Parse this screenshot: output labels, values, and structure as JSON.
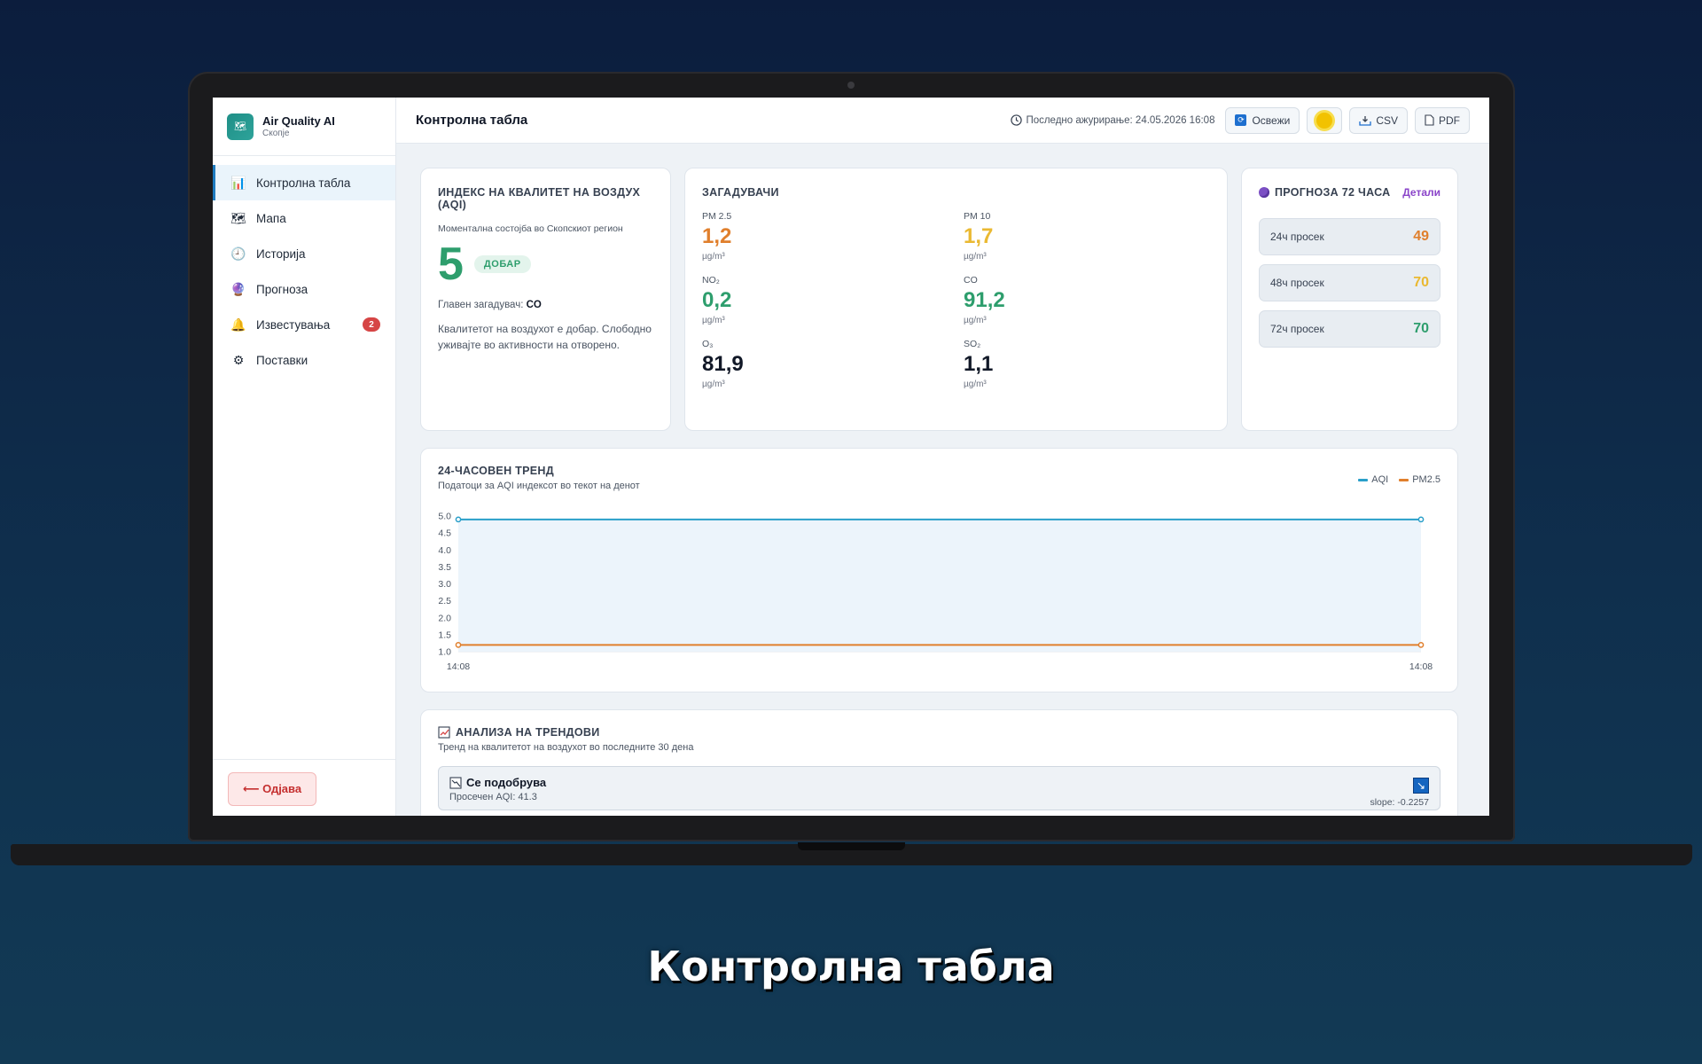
{
  "app": {
    "name": "Air Quality AI",
    "city": "Скопје",
    "logo_glyph": "🗺"
  },
  "sidebar": {
    "items": [
      {
        "label": "Контролна табла",
        "icon": "bar-chart-icon",
        "glyph": "📊",
        "active": true
      },
      {
        "label": "Мапа",
        "icon": "map-icon",
        "glyph": "🗺",
        "active": false
      },
      {
        "label": "Историја",
        "icon": "clock-icon",
        "glyph": "🕘",
        "active": false
      },
      {
        "label": "Прогноза",
        "icon": "crystal-ball-icon",
        "glyph": "🔮",
        "active": false
      },
      {
        "label": "Известувања",
        "icon": "bell-icon",
        "glyph": "🔔",
        "active": false,
        "badge": "2"
      },
      {
        "label": "Поставки",
        "icon": "gear-icon",
        "glyph": "⚙",
        "active": false
      }
    ],
    "logout_label": "⟵ Одјава"
  },
  "header": {
    "title": "Контролна табла",
    "last_updated": "Последно ажурирање: 24.05.2026 16:08",
    "refresh_label": "Освежи",
    "csv_label": "CSV",
    "pdf_label": "PDF"
  },
  "aqi": {
    "title": "ИНДЕКС НА КВАЛИТЕТ НА ВОЗДУХ (AQI)",
    "subtitle": "Моментална состојба во Скопскиот регион",
    "value": "5",
    "badge": "ДОБАР",
    "main_pollutant_label": "Главен загадувач:",
    "main_pollutant": "CO",
    "description": "Квалитетот на воздухот е добар. Слободно уживајте во активности на отворено.",
    "color": "#2e9e6d"
  },
  "pollutants": {
    "title": "ЗАГАДУВАЧИ",
    "items": [
      {
        "name": "PM 2.5",
        "value": "1,2",
        "unit": "µg/m³",
        "color": "#e07f2c"
      },
      {
        "name": "PM 10",
        "value": "1,7",
        "unit": "µg/m³",
        "color": "#eab932"
      },
      {
        "name": "NO₂",
        "value": "0,2",
        "unit": "µg/m³",
        "color": "#2e9e6d"
      },
      {
        "name": "CO",
        "value": "91,2",
        "unit": "µg/m³",
        "color": "#2e9e6d"
      },
      {
        "name": "O₃",
        "value": "81,9",
        "unit": "µg/m³",
        "color": "#111827"
      },
      {
        "name": "SO₂",
        "value": "1,1",
        "unit": "µg/m³",
        "color": "#111827"
      }
    ]
  },
  "forecast": {
    "title": "ПРОГНОЗА 72 ЧАСА",
    "details_label": "Детали",
    "items": [
      {
        "label": "24ч просек",
        "value": "49",
        "color": "#e07f2c"
      },
      {
        "label": "48ч просек",
        "value": "70",
        "color": "#eab932"
      },
      {
        "label": "72ч просек",
        "value": "70",
        "color": "#2e9e6d"
      }
    ]
  },
  "trend": {
    "title": "24-ЧАСОВЕН ТРЕНД",
    "subtitle": "Податоци за AQI индексот во текот на денот"
  },
  "chart_data": {
    "type": "line",
    "x": [
      "14:08",
      "14:08"
    ],
    "series": [
      {
        "name": "AQI",
        "values": [
          4.9,
          4.9
        ],
        "color": "#2a9fc9"
      },
      {
        "name": "PM2.5",
        "values": [
          1.2,
          1.2
        ],
        "color": "#e07f2c"
      }
    ],
    "yticks": [
      "5.0",
      "4.5",
      "4.0",
      "3.5",
      "3.0",
      "2.5",
      "2.0",
      "1.5",
      "1.0"
    ],
    "ylim": [
      1.0,
      5.0
    ],
    "legend_position": "top-right",
    "grid": false
  },
  "analysis": {
    "title": "АНАЛИЗА НА ТРЕНДОВИ",
    "subtitle": "Тренд на квалитетот на воздухот во последните 30 дена",
    "status": "Се подобрува",
    "average": "Просечен AQI: 41.3",
    "slope": "slope: -0.2257"
  },
  "caption": "Контролна табла"
}
